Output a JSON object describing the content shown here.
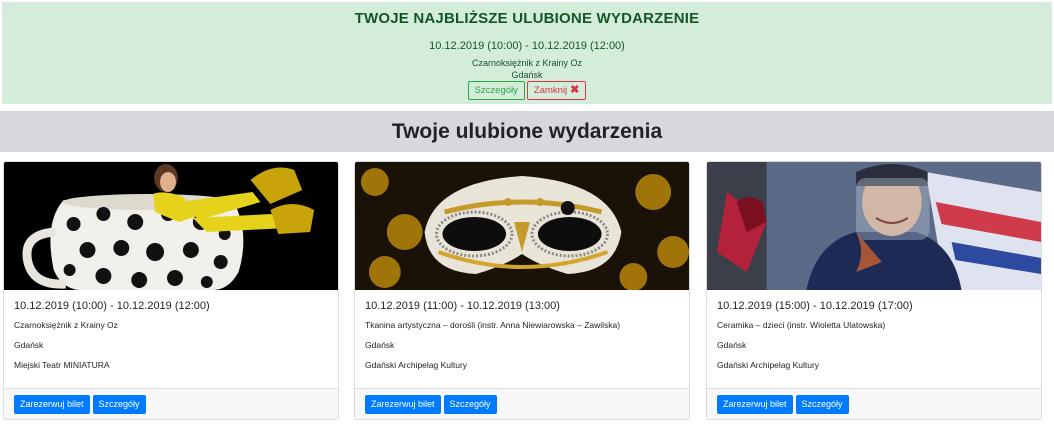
{
  "banner": {
    "title": "TWOJE NAJBLIŻSZE ULUBIONE WYDARZENIE",
    "date": "10.12.2019 (10:00) - 10.12.2019 (12:00)",
    "event_name": "Czarnoksiężnik z Krainy Oz",
    "city": "Gdańsk",
    "details_label": "Szczegóły",
    "close_label": "Zamknij",
    "close_icon": "close-x-icon",
    "close_icon_glyph": "✖",
    "colors": {
      "background": "#d4edda",
      "text": "#155724",
      "success": "#28a745",
      "danger": "#dc3545"
    }
  },
  "section": {
    "title": "Twoje ulubione wydarzenia"
  },
  "cards": [
    {
      "date": "10.12.2019 (10:00) - 10.12.2019 (12:00)",
      "name": "Czarnoksiężnik z Krainy Oz",
      "city": "Gdańsk",
      "venue": "Miejski Teatr MINIATURA",
      "reserve_label": "Zarezerwuj bilet",
      "details_label": "Szczegóły",
      "image": "woman-in-giant-polka-dot-teacup"
    },
    {
      "date": "10.12.2019 (11:00) - 10.12.2019 (13:00)",
      "name": "Tkanina artystyczna – dorośli (instr. Anna Niewiarowska – Zawilska)",
      "city": "Gdańsk",
      "venue": "Gdański Archipelag Kultury",
      "reserve_label": "Zarezerwuj bilet",
      "details_label": "Szczegóły",
      "image": "venetian-carnival-mask"
    },
    {
      "date": "10.12.2019 (15:00) - 10.12.2019 (17:00)",
      "name": "Ceramika – dzieci (instr. Wioletta Ulatowska)",
      "city": "Gdańsk",
      "venue": "Gdański Archipelag Kultury",
      "reserve_label": "Zarezerwuj bilet",
      "details_label": "Szczegóły",
      "image": "woman-with-face-shield"
    }
  ],
  "colors": {
    "primary": "#007bff",
    "section_bg": "#d6d8db",
    "card_footer": "#f7f7f7"
  }
}
